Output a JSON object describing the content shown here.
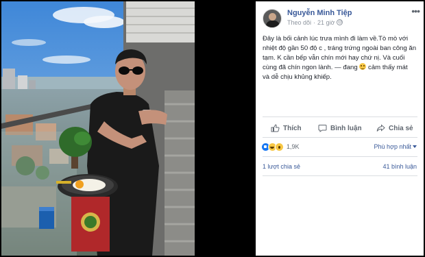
{
  "post": {
    "author": "Nguyễn Minh Tiệp",
    "follow_label": "Theo dõi",
    "time": "21 giờ",
    "text_lines": [
      "Đây là bối cảnh lúc trưa mình đi làm về.Tò mò với",
      "nhiệt độ gần 50 độ c , tráng trứng ngoài ban công ăn",
      "tạm. K cần bếp vẫn chín mới hay chứ nị. Và cuối",
      "cùng đã chín ngon lành."
    ],
    "feeling_prefix": "— đang",
    "feeling_text": "cảm thấy mát",
    "feeling_line2": "và dễ chịu khủng khiếp."
  },
  "actions": {
    "like": "Thích",
    "comment": "Bình luận",
    "share": "Chia sẻ"
  },
  "stats": {
    "reaction_count": "1,9K",
    "sort_label": "Phù hợp nhất",
    "shares": "1 lượt chia sẻ",
    "comments": "41 bình luận"
  },
  "colors": {
    "link": "#385898",
    "text": "#1d2129",
    "muted": "#606770",
    "like_blue": "#1877f2",
    "emoji_yellow": "#f7c744"
  },
  "icons": [
    "more-options-icon",
    "globe-icon",
    "like-icon",
    "comment-icon",
    "share-icon",
    "like-reaction-icon",
    "haha-reaction-icon",
    "wow-reaction-icon",
    "smile-emoji-icon"
  ]
}
